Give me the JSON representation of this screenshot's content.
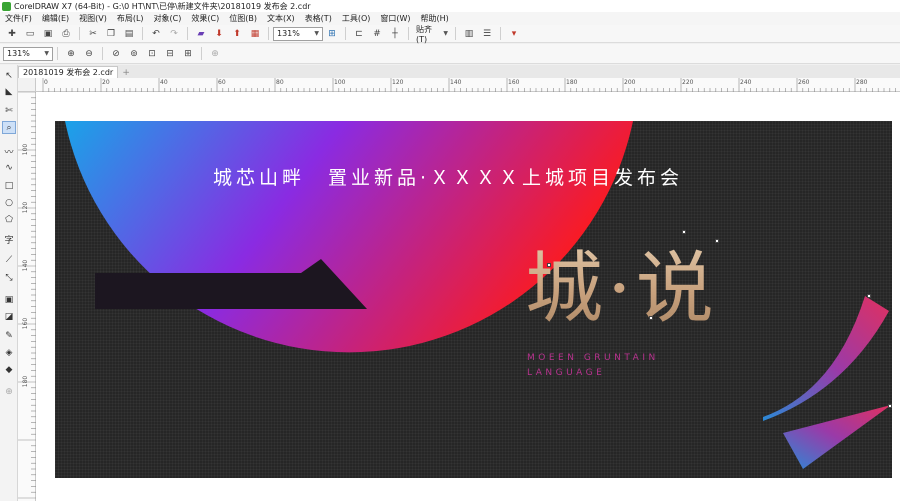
{
  "window": {
    "title": "CorelDRAW X7 (64-Bit) - G:\\0 HT\\NT\\已停\\新建文件夹\\20181019 发布会 2.cdr"
  },
  "menu": [
    "文件(F)",
    "编辑(E)",
    "视图(V)",
    "布局(L)",
    "对象(C)",
    "效果(C)",
    "位图(B)",
    "文本(X)",
    "表格(T)",
    "工具(O)",
    "窗口(W)",
    "帮助(H)"
  ],
  "toolbar": {
    "zoom_value": "131%",
    "snap_label": "贴齐(T)"
  },
  "propertybar": {
    "zoom_value": "131%"
  },
  "document": {
    "tab_label": "20181019 发布会 2.cdr"
  },
  "ruler": {
    "h_labels": [
      "0",
      "20",
      "40",
      "60",
      "80",
      "100",
      "120",
      "140",
      "160",
      "180",
      "200",
      "220",
      "240",
      "260",
      "280"
    ],
    "v_labels": [
      "100",
      "120",
      "140",
      "160",
      "180"
    ]
  },
  "design": {
    "headline": "城芯山畔　置业新品·ＸＸＸＸ上城项目发布会",
    "big_title": "城·说",
    "subtitle_line1": "MOEEN GRUNTAIN",
    "subtitle_line2": "LANGUAGE",
    "colors": {
      "background": "#262626",
      "gradient_blue": "#1aa3e8",
      "gradient_purple": "#8a2be2",
      "gradient_red": "#ff1a1a",
      "gold": "#d6b895",
      "subtitle": "#b8338f"
    }
  },
  "icons": [
    "new-icon",
    "open-icon",
    "save-icon",
    "print-icon",
    "cut-icon",
    "copy-icon",
    "paste-icon",
    "undo-icon",
    "redo-icon",
    "search-content-icon",
    "import-icon",
    "export-icon",
    "publish-pdf-icon",
    "app-launcher-icon",
    "full-screen-icon",
    "show-rulers-icon",
    "show-grid-icon",
    "show-guidelines-icon",
    "snap-options-icon",
    "options-icon",
    "launch-icon"
  ]
}
